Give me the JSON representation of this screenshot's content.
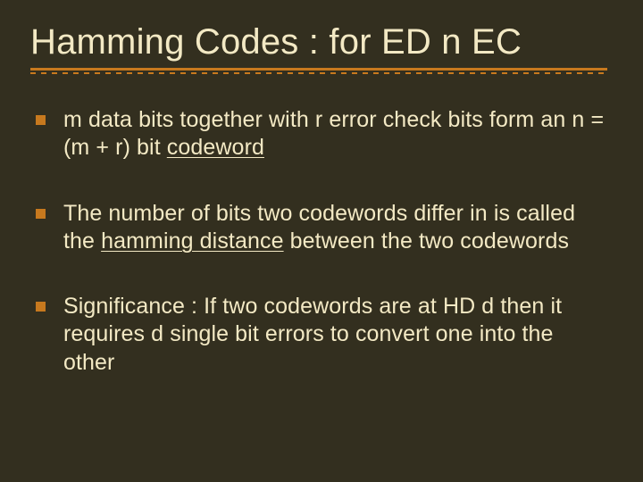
{
  "title": "Hamming Codes : for ED n EC",
  "bullets": [
    {
      "parts": [
        {
          "t": "m data bits together with r error check bits form an n = (m + r) bit "
        },
        {
          "t": "codeword",
          "u": true
        }
      ]
    },
    {
      "parts": [
        {
          "t": "The number of bits two codewords differ in is called the "
        },
        {
          "t": "hamming distance",
          "u": true
        },
        {
          "t": " between the two codewords"
        }
      ]
    },
    {
      "parts": [
        {
          "t": "Significance : If two codewords are at HD d then it requires d single bit errors to convert one into the other"
        }
      ]
    }
  ]
}
